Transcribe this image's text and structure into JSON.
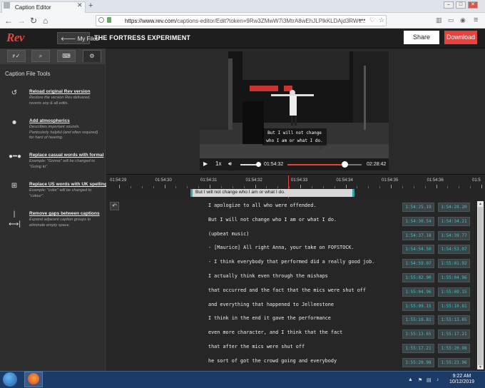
{
  "browser": {
    "tab_title": "Caption Editor",
    "url_host": "https://www.rev.com",
    "url_path": "/captions-editor/Edit?token=9Rw3ZMwW7i3MtrA8wEhJLPlkKLDAjd3RWv..."
  },
  "header": {
    "logo": "Rev",
    "my_files": "My Files",
    "project_title": "THE FORTRESS EXPERIMENT",
    "share": "Share",
    "download": "Download"
  },
  "sidebar": {
    "title": "Caption File Tools",
    "tools": [
      {
        "title": "Reload original Rev version",
        "desc": "Restore the version Rev delivered, reverts any & all edits."
      },
      {
        "title": "Add atmospherics",
        "desc": "Describes important sounds. Particularly helpful (and often required) for hard of hearing."
      },
      {
        "title": "Replace casual words with formal",
        "desc": "Example: \"Gonna\" will be changed to \"Going to\"."
      },
      {
        "title": "Replace US words with UK spelling",
        "desc": "Example: \"color\" will be changed to \"colour\"."
      },
      {
        "title": "Remove gaps between captions",
        "desc": "Expand adjacent caption groups to eliminate empty space."
      }
    ]
  },
  "video": {
    "caption_line1": "But I will not change",
    "caption_line2": "who I am or what I do.",
    "speed": "1x",
    "current_time": "01:54:32",
    "duration": "02:28:42",
    "progress": 0.77,
    "volume": 0.85
  },
  "timeline": {
    "ticks": [
      "01:54:29",
      "01:54:30",
      "01:54:31",
      "01:54:32",
      "01:54:33",
      "01:54:34",
      "01:54:35",
      "01:54:36",
      "01:5"
    ],
    "segment_text": "But I will not change who I am or what I do."
  },
  "transcript": [
    {
      "text": "I apologize to all who were offended.",
      "start": "1:54:25.19",
      "end": "1:54:28.20"
    },
    {
      "text": "But I will not change who I am or what I do.",
      "start": "1:54:30.54",
      "end": "1:54:34.21"
    },
    {
      "text": "(upbeat music)",
      "start": "1:54:37.18",
      "end": "1:54:39.77"
    },
    {
      "text": "- [Maurice] All right Anna, your take on FOFSTOCK.",
      "start": "1:54:54.50",
      "end": "1:54:53.07"
    },
    {
      "text": "- I think everybody that performed did a really good job.",
      "start": "1:54:59.07",
      "end": "1:55:01.92"
    },
    {
      "text": "I actually think even through the mishaps",
      "start": "1:55:02.90",
      "end": "1:55:04.96"
    },
    {
      "text": "that occurred and the fact that the mics were shut off",
      "start": "1:55:04.96",
      "end": "1:55:09.15"
    },
    {
      "text": "and everything that happened to Jelleestone",
      "start": "1:55:09.15",
      "end": "1:55:10.81"
    },
    {
      "text": "I think in the end it gave the performance",
      "start": "1:55:10.81",
      "end": "1:55:13.65"
    },
    {
      "text": "even more character, and I think that the fact",
      "start": "1:55:13.65",
      "end": "1:55:17.21"
    },
    {
      "text": "that after the mics were shut off",
      "start": "1:55:17.21",
      "end": "1:55:20.98"
    },
    {
      "text": "he sort of got the crowd going and everybody",
      "start": "1:55:20.98",
      "end": "1:55:23.96"
    }
  ],
  "taskbar": {
    "time": "9:22 AM",
    "date": "10/12/2019"
  }
}
